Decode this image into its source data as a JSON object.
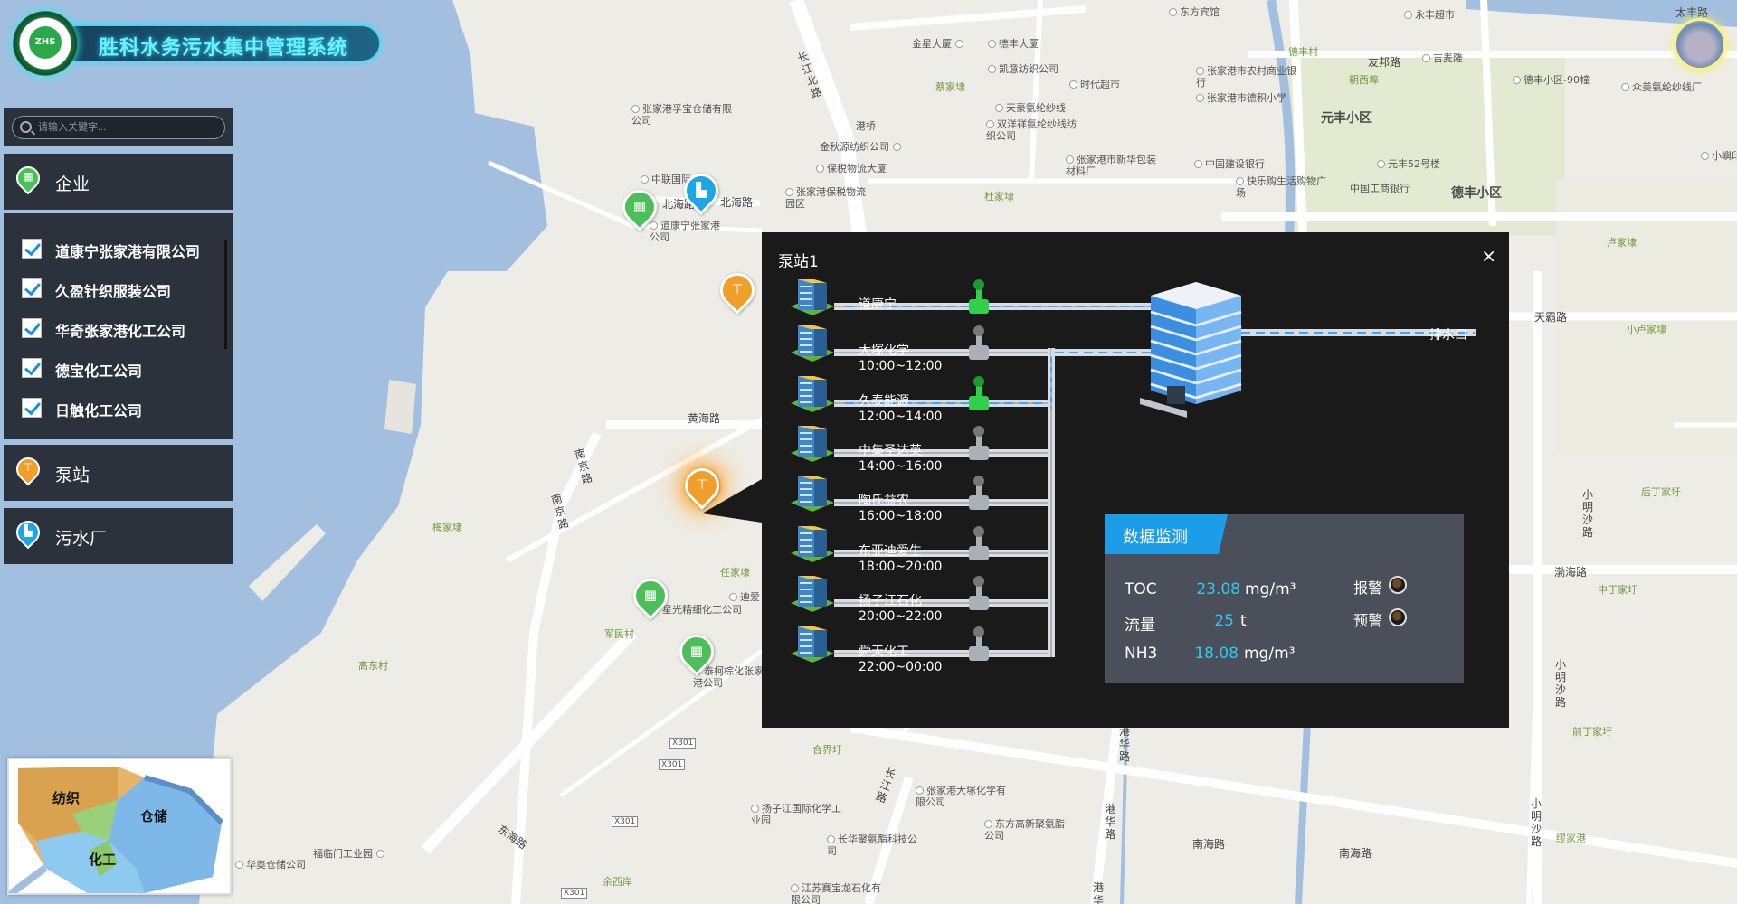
{
  "app": {
    "title": "胜科水务污水集中管理系统",
    "logo_text": "ZHS"
  },
  "search": {
    "placeholder": "请输入关键字..."
  },
  "sidebar": {
    "enterprise": {
      "label": "企业"
    },
    "enterprises": [
      {
        "label": "道康宁张家港有限公司",
        "checked": true
      },
      {
        "label": "久盈针织服装公司",
        "checked": true
      },
      {
        "label": "华奇张家港化工公司",
        "checked": true
      },
      {
        "label": "德宝化工公司",
        "checked": true
      },
      {
        "label": "日触化工公司",
        "checked": true
      }
    ],
    "pump": {
      "label": "泵站"
    },
    "wastewater": {
      "label": "污水厂"
    }
  },
  "popup": {
    "title": "泵站1",
    "close": "×",
    "outlet": "排水口",
    "stations": [
      {
        "name": "道康宁",
        "time": "",
        "valve": "green"
      },
      {
        "name": "大塚化学",
        "time": "10:00~12:00",
        "valve": "gray"
      },
      {
        "name": "久泰能源",
        "time": "12:00~14:00",
        "valve": "green"
      },
      {
        "name": "中集圣达英",
        "time": "14:00~16:00",
        "valve": "gray"
      },
      {
        "name": "陶氏益农",
        "time": "16:00~18:00",
        "valve": "gray"
      },
      {
        "name": "东亚迪爱生",
        "time": "18:00~20:00",
        "valve": "gray"
      },
      {
        "name": "扬子江石化",
        "time": "20:00~22:00",
        "valve": "gray"
      },
      {
        "name": "舜天化工",
        "time": "22:00~00:00",
        "valve": "gray"
      }
    ],
    "monitor": {
      "title": "数据监测",
      "rows": [
        {
          "name": "TOC",
          "value": "23.08",
          "unit": "mg/m³"
        },
        {
          "name": "流量",
          "value": "25",
          "unit": "t"
        },
        {
          "name": "NH3",
          "value": "18.08",
          "unit": "mg/m³"
        }
      ],
      "alarm_label": "报警",
      "warning_label": "预警"
    }
  },
  "inset": {
    "labels": [
      "纺织",
      "仓储",
      "化工"
    ]
  },
  "map": {
    "labels": [
      "东方宾馆",
      "永丰超市",
      "太丰路",
      "金星大厦",
      "德丰大厦",
      "凯意纺织公司",
      "德丰村",
      "友邦路",
      "吉麦隆",
      "张家港市农村商业银行",
      "张家港市德积小学",
      "时代超市",
      "天豪氨纶纱线",
      "双洋祥氨纶纱线纺织公司",
      "元丰小区",
      "朝西埠",
      "德丰小区-90幢",
      "众美氨纶纱线厂",
      "张家港孚宝仓储有限公司",
      "蔡家埭",
      "港桥",
      "金秋源纺织公司",
      "保税物流大厦",
      "张家港市新华包装材料厂",
      "中国建设银行",
      "元丰52号楼",
      "小嶼印",
      "中联国际",
      "北海路",
      "张家港保税物流园区",
      "快乐购生活购物广场",
      "中国工商银行",
      "德丰小区",
      "杜家埭",
      "道康宁张家港公司",
      "卢家埭",
      "天霸路",
      "小卢家埭",
      "黄海路",
      "南京路",
      "梅家埭",
      "任家埭",
      "星光精细化工公司",
      "迪爱",
      "军民村",
      "泰柯棕化张家港公司",
      "高东村",
      "X301",
      "合界圩",
      "张家港大塚化学有限公司",
      "长江路",
      "扬子江国际化学工业园",
      "东方高新聚氨酯公司",
      "长华聚氨酯科技公司",
      "福临门工业园",
      "华奥仓储公司",
      "南海路",
      "东海路",
      "余西岸",
      "江苏赛宝龙石化有限公司",
      "渤海路",
      "小明沙路",
      "后丁家圩",
      "中丁家圩",
      "前丁家圩",
      "缪家港",
      "港华路",
      "长江北路"
    ]
  }
}
